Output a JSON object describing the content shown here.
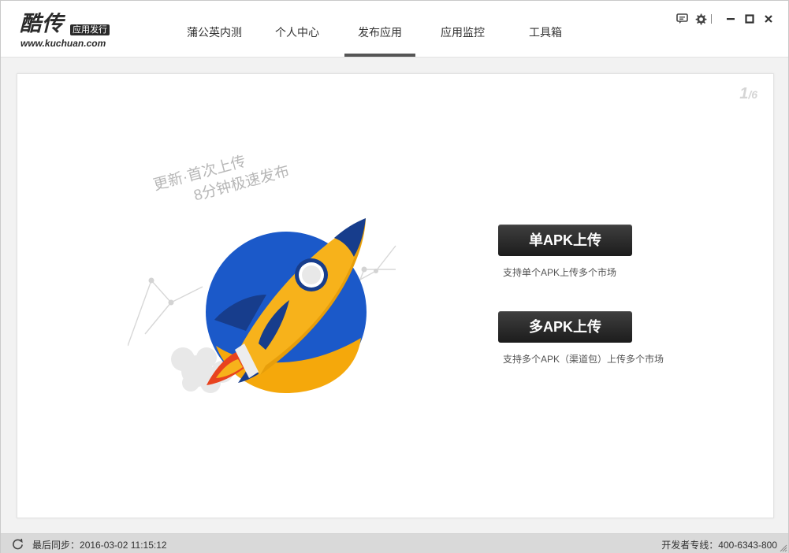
{
  "app": {
    "logo_main": "酷传",
    "logo_badge": "应用发行",
    "logo_url": "www.kuchuan.com"
  },
  "nav": {
    "items": [
      {
        "label": "蒲公英内测",
        "active": false
      },
      {
        "label": "个人中心",
        "active": false
      },
      {
        "label": "发布应用",
        "active": true
      },
      {
        "label": "应用监控",
        "active": false
      },
      {
        "label": "工具箱",
        "active": false
      }
    ]
  },
  "window_controls": {
    "icons": [
      "feedback-icon",
      "gear-icon",
      "minimize-icon",
      "maximize-icon",
      "close-icon"
    ]
  },
  "main": {
    "pager": {
      "current": "1",
      "separator": "/",
      "total": "6"
    },
    "slogan": {
      "line1": "更新·首次上传",
      "line2": "8分钟极速发布"
    },
    "single_apk": {
      "button_label": "单APK上传",
      "description": "支持单个APK上传多个市场"
    },
    "multi_apk": {
      "button_label": "多APK上传",
      "description": "支持多个APK（渠道包）上传多个市场"
    }
  },
  "status": {
    "sync_label": "最后同步：",
    "sync_time": "2016-03-02 11:15:12",
    "hotline_label": "开发者专线：",
    "hotline_number": "400-6343-800"
  },
  "colors": {
    "rocket_body": "#f7b21b",
    "planet_blue": "#1b59c9",
    "rocket_dark": "#173d8c",
    "flame_red": "#e8431e",
    "button_dark": "#2b2b2b",
    "statusbar_bg": "#d9d9d9"
  }
}
